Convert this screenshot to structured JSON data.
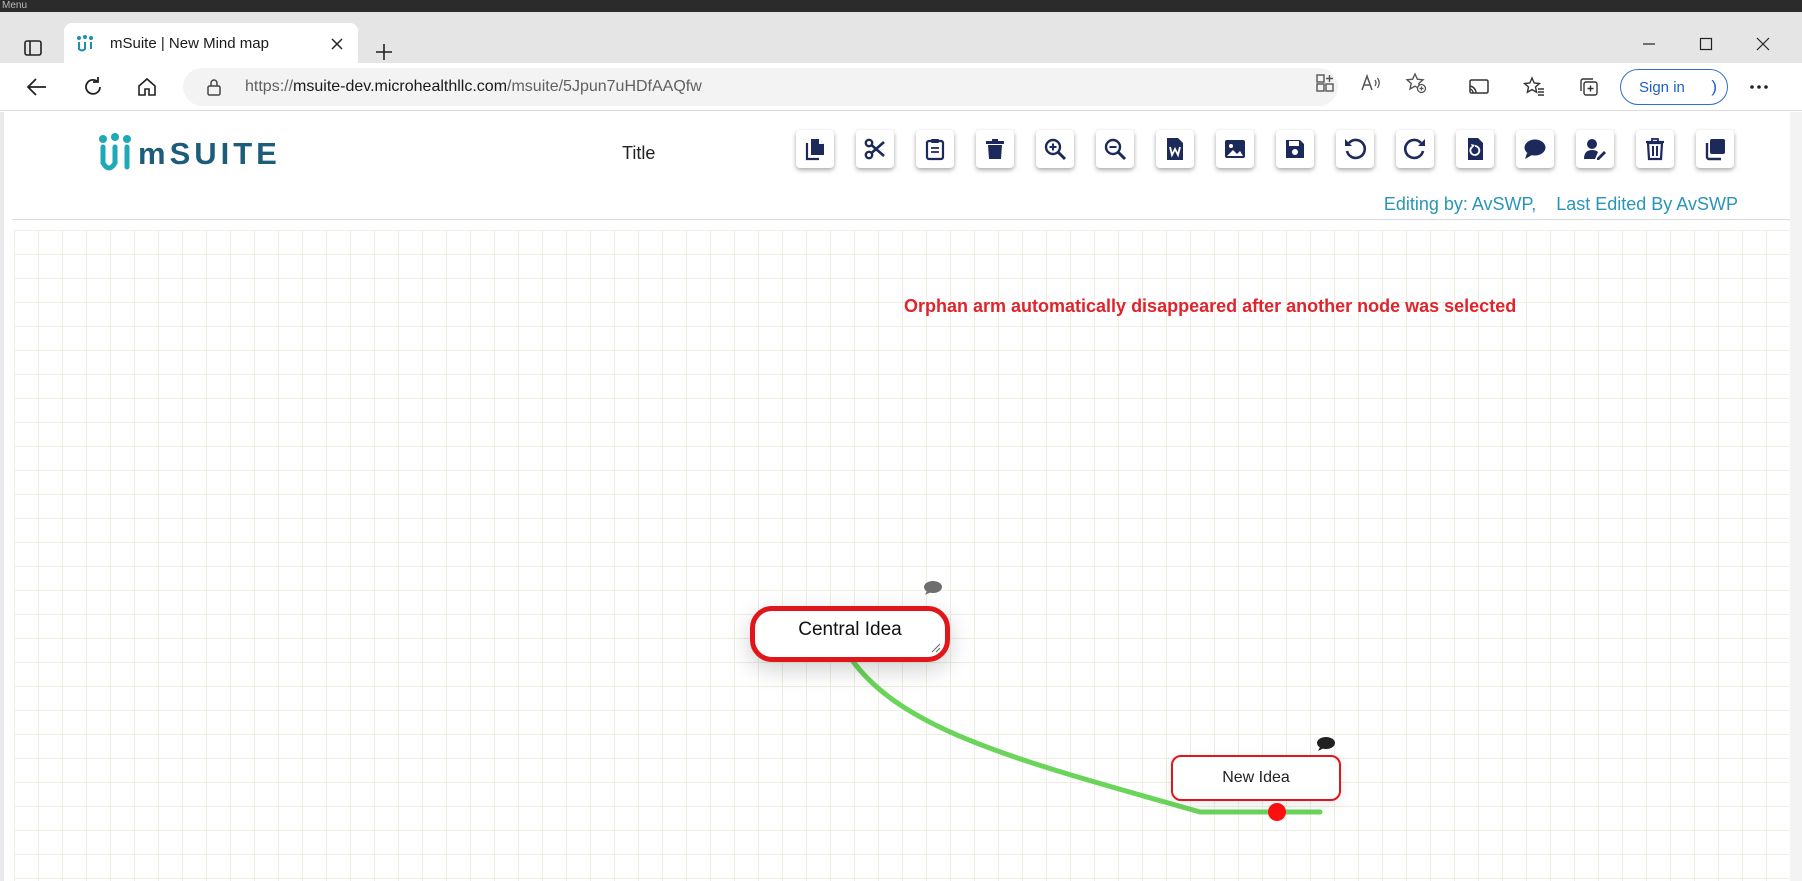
{
  "os": {
    "text": "Menu"
  },
  "browser": {
    "tab": {
      "title": "mSuite | New Mind map"
    },
    "address": {
      "scheme": "https://",
      "host": "msuite-dev.microhealthllc.com",
      "path": "/msuite/5Jpun7uHDfAAQfw"
    },
    "sign_in_label": "Sign in",
    "sign_in_suffix": ")"
  },
  "app": {
    "logo_text": "mSUITE",
    "title": "Title",
    "toolbar": [
      {
        "name": "copy",
        "icon": "copy-icon"
      },
      {
        "name": "cut",
        "icon": "scissors-icon"
      },
      {
        "name": "paste",
        "icon": "clipboard-icon"
      },
      {
        "name": "delete",
        "icon": "trash-icon"
      },
      {
        "name": "zoom-in",
        "icon": "zoom-in-icon"
      },
      {
        "name": "zoom-out",
        "icon": "zoom-out-icon"
      },
      {
        "name": "export-word",
        "icon": "word-file-icon"
      },
      {
        "name": "export-image",
        "icon": "image-icon"
      },
      {
        "name": "save",
        "icon": "floppy-icon"
      },
      {
        "name": "undo",
        "icon": "undo-icon"
      },
      {
        "name": "redo",
        "icon": "redo-icon"
      },
      {
        "name": "reset",
        "icon": "file-reset-icon"
      },
      {
        "name": "comments",
        "icon": "comment-icon"
      },
      {
        "name": "user-edit",
        "icon": "user-edit-icon"
      },
      {
        "name": "delete-map",
        "icon": "trash-bin-icon"
      },
      {
        "name": "duplicate",
        "icon": "clone-icon"
      }
    ],
    "editing_by": "Editing by: AvSWP,",
    "last_edited_by": "Last Edited By AvSWP",
    "annotation": "Orphan arm automatically disappeared after another node was selected",
    "nodes": {
      "central": {
        "label": "Central Idea"
      },
      "new": {
        "label": "New Idea"
      }
    },
    "colors": {
      "node_border": "#e0161b",
      "edge": "#6bd45a",
      "accent": "#1d5d7a",
      "navy_icon": "#1c2a5b",
      "annotation": "#e0242c"
    }
  }
}
